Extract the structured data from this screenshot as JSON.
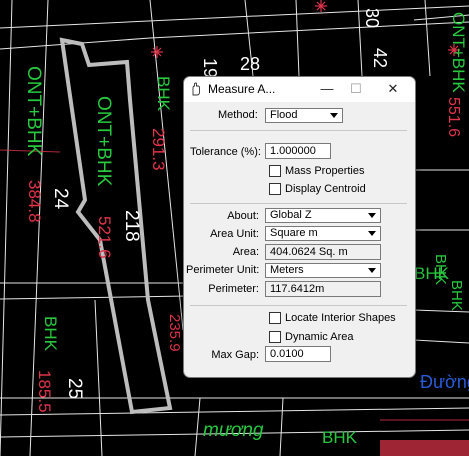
{
  "dialog": {
    "title": "Measure A...",
    "method_label": "Method:",
    "method_value": "Flood",
    "tolerance_label": "Tolerance (%):",
    "tolerance_value": "1.000000",
    "mass_properties": "Mass Properties",
    "display_centroid": "Display Centroid",
    "about_label": "About:",
    "about_value": "Global Z",
    "area_unit_label": "Area Unit:",
    "area_unit_value": "Square m",
    "area_label": "Area:",
    "area_value": "404.0624 Sq. m",
    "perimeter_unit_label": "Perimeter Unit:",
    "perimeter_unit_value": "Meters",
    "perimeter_label": "Perimeter:",
    "perimeter_value": "117.6412m",
    "locate_interior": "Locate Interior Shapes",
    "dynamic_area": "Dynamic Area",
    "max_gap_label": "Max Gap:",
    "max_gap_value": "0.0100",
    "window_controls": {
      "minimize": "—",
      "maximize": "☐",
      "close": "✕"
    }
  },
  "drawing": {
    "labels": [
      {
        "name": "label-ont-bhk-1",
        "text": "ONT+BHK",
        "color": "#27c93f"
      },
      {
        "name": "label-ont-bhk-2",
        "text": "ONT+BHK",
        "color": "#27c93f"
      },
      {
        "name": "label-ont-bhk-3",
        "text": "ONT+BHK",
        "color": "#27c93f"
      },
      {
        "name": "label-384",
        "text": "384.8",
        "color": "#e0344a"
      },
      {
        "name": "label-521",
        "text": "521.6",
        "color": "#e0344a"
      },
      {
        "name": "label-291",
        "text": "291.3",
        "color": "#e0344a"
      },
      {
        "name": "label-551",
        "text": "551.6",
        "color": "#e0344a"
      },
      {
        "name": "label-185",
        "text": "185.5",
        "color": "#e0344a"
      },
      {
        "name": "label-235",
        "text": "235.9",
        "color": "#e0344a"
      },
      {
        "name": "label-24",
        "text": "24",
        "color": "#ffffff"
      },
      {
        "name": "label-218",
        "text": "218",
        "color": "#ffffff"
      },
      {
        "name": "label-25",
        "text": "25",
        "color": "#ffffff"
      },
      {
        "name": "label-28",
        "text": "28",
        "color": "#ffffff"
      },
      {
        "name": "label-19",
        "text": "19",
        "color": "#ffffff"
      },
      {
        "name": "label-30",
        "text": "30",
        "color": "#ffffff"
      },
      {
        "name": "label-42",
        "text": "42",
        "color": "#ffffff"
      },
      {
        "name": "label-bhk-1",
        "text": "BHK",
        "color": "#27c93f"
      },
      {
        "name": "label-bhk-2",
        "text": "BHK",
        "color": "#27c93f"
      },
      {
        "name": "label-bhk-3",
        "text": "BHK",
        "color": "#27c93f"
      },
      {
        "name": "label-bhk-4",
        "text": "BHK",
        "color": "#27c93f"
      },
      {
        "name": "label-bhk-5",
        "text": "BHK",
        "color": "#27c93f"
      },
      {
        "name": "label-bhk-6",
        "text": "BHK",
        "color": "#27c93f"
      },
      {
        "name": "label-muong",
        "text": "mương",
        "color": "#27c93f"
      },
      {
        "name": "label-duong",
        "text": "Đường",
        "color": "#2a5bd7"
      }
    ]
  }
}
